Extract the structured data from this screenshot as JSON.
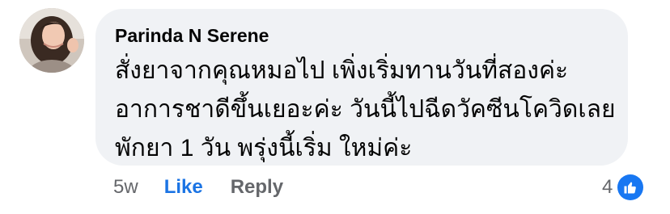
{
  "comment": {
    "author": "Parinda N Serene",
    "lines": [
      "สั่งยาจากคุณหมอไป เพิ่งเริ่มทานวันที่สองค่ะ",
      "อาการชาดีขึ้นเยอะค่ะ วันนี้ไปฉีดวัคซีนโควิดเลย",
      "พักยา 1 วัน พรุ่งนี้เริ่ม ใหม่ค่ะ"
    ],
    "time": "5w",
    "like_label": "Like",
    "reply_label": "Reply",
    "reaction_count": "4",
    "reaction_icon": "thumbs-up-icon",
    "colors": {
      "bubble": "#f0f2f5",
      "like_active": "#1b74e4",
      "meta": "#65676b",
      "reaction_badge": "#1877f2"
    }
  }
}
